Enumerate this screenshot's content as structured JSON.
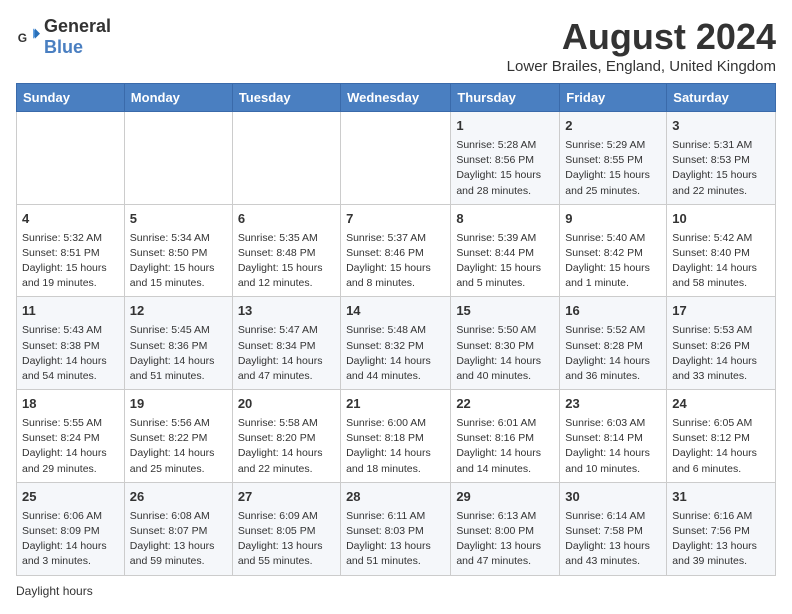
{
  "header": {
    "logo_general": "General",
    "logo_blue": "Blue",
    "month_year": "August 2024",
    "location": "Lower Brailes, England, United Kingdom"
  },
  "days_of_week": [
    "Sunday",
    "Monday",
    "Tuesday",
    "Wednesday",
    "Thursday",
    "Friday",
    "Saturday"
  ],
  "weeks": [
    [
      {
        "day": "",
        "info": ""
      },
      {
        "day": "",
        "info": ""
      },
      {
        "day": "",
        "info": ""
      },
      {
        "day": "",
        "info": ""
      },
      {
        "day": "1",
        "info": "Sunrise: 5:28 AM\nSunset: 8:56 PM\nDaylight: 15 hours\nand 28 minutes."
      },
      {
        "day": "2",
        "info": "Sunrise: 5:29 AM\nSunset: 8:55 PM\nDaylight: 15 hours\nand 25 minutes."
      },
      {
        "day": "3",
        "info": "Sunrise: 5:31 AM\nSunset: 8:53 PM\nDaylight: 15 hours\nand 22 minutes."
      }
    ],
    [
      {
        "day": "4",
        "info": "Sunrise: 5:32 AM\nSunset: 8:51 PM\nDaylight: 15 hours\nand 19 minutes."
      },
      {
        "day": "5",
        "info": "Sunrise: 5:34 AM\nSunset: 8:50 PM\nDaylight: 15 hours\nand 15 minutes."
      },
      {
        "day": "6",
        "info": "Sunrise: 5:35 AM\nSunset: 8:48 PM\nDaylight: 15 hours\nand 12 minutes."
      },
      {
        "day": "7",
        "info": "Sunrise: 5:37 AM\nSunset: 8:46 PM\nDaylight: 15 hours\nand 8 minutes."
      },
      {
        "day": "8",
        "info": "Sunrise: 5:39 AM\nSunset: 8:44 PM\nDaylight: 15 hours\nand 5 minutes."
      },
      {
        "day": "9",
        "info": "Sunrise: 5:40 AM\nSunset: 8:42 PM\nDaylight: 15 hours\nand 1 minute."
      },
      {
        "day": "10",
        "info": "Sunrise: 5:42 AM\nSunset: 8:40 PM\nDaylight: 14 hours\nand 58 minutes."
      }
    ],
    [
      {
        "day": "11",
        "info": "Sunrise: 5:43 AM\nSunset: 8:38 PM\nDaylight: 14 hours\nand 54 minutes."
      },
      {
        "day": "12",
        "info": "Sunrise: 5:45 AM\nSunset: 8:36 PM\nDaylight: 14 hours\nand 51 minutes."
      },
      {
        "day": "13",
        "info": "Sunrise: 5:47 AM\nSunset: 8:34 PM\nDaylight: 14 hours\nand 47 minutes."
      },
      {
        "day": "14",
        "info": "Sunrise: 5:48 AM\nSunset: 8:32 PM\nDaylight: 14 hours\nand 44 minutes."
      },
      {
        "day": "15",
        "info": "Sunrise: 5:50 AM\nSunset: 8:30 PM\nDaylight: 14 hours\nand 40 minutes."
      },
      {
        "day": "16",
        "info": "Sunrise: 5:52 AM\nSunset: 8:28 PM\nDaylight: 14 hours\nand 36 minutes."
      },
      {
        "day": "17",
        "info": "Sunrise: 5:53 AM\nSunset: 8:26 PM\nDaylight: 14 hours\nand 33 minutes."
      }
    ],
    [
      {
        "day": "18",
        "info": "Sunrise: 5:55 AM\nSunset: 8:24 PM\nDaylight: 14 hours\nand 29 minutes."
      },
      {
        "day": "19",
        "info": "Sunrise: 5:56 AM\nSunset: 8:22 PM\nDaylight: 14 hours\nand 25 minutes."
      },
      {
        "day": "20",
        "info": "Sunrise: 5:58 AM\nSunset: 8:20 PM\nDaylight: 14 hours\nand 22 minutes."
      },
      {
        "day": "21",
        "info": "Sunrise: 6:00 AM\nSunset: 8:18 PM\nDaylight: 14 hours\nand 18 minutes."
      },
      {
        "day": "22",
        "info": "Sunrise: 6:01 AM\nSunset: 8:16 PM\nDaylight: 14 hours\nand 14 minutes."
      },
      {
        "day": "23",
        "info": "Sunrise: 6:03 AM\nSunset: 8:14 PM\nDaylight: 14 hours\nand 10 minutes."
      },
      {
        "day": "24",
        "info": "Sunrise: 6:05 AM\nSunset: 8:12 PM\nDaylight: 14 hours\nand 6 minutes."
      }
    ],
    [
      {
        "day": "25",
        "info": "Sunrise: 6:06 AM\nSunset: 8:09 PM\nDaylight: 14 hours\nand 3 minutes."
      },
      {
        "day": "26",
        "info": "Sunrise: 6:08 AM\nSunset: 8:07 PM\nDaylight: 13 hours\nand 59 minutes."
      },
      {
        "day": "27",
        "info": "Sunrise: 6:09 AM\nSunset: 8:05 PM\nDaylight: 13 hours\nand 55 minutes."
      },
      {
        "day": "28",
        "info": "Sunrise: 6:11 AM\nSunset: 8:03 PM\nDaylight: 13 hours\nand 51 minutes."
      },
      {
        "day": "29",
        "info": "Sunrise: 6:13 AM\nSunset: 8:00 PM\nDaylight: 13 hours\nand 47 minutes."
      },
      {
        "day": "30",
        "info": "Sunrise: 6:14 AM\nSunset: 7:58 PM\nDaylight: 13 hours\nand 43 minutes."
      },
      {
        "day": "31",
        "info": "Sunrise: 6:16 AM\nSunset: 7:56 PM\nDaylight: 13 hours\nand 39 minutes."
      }
    ]
  ],
  "note": "Daylight hours"
}
